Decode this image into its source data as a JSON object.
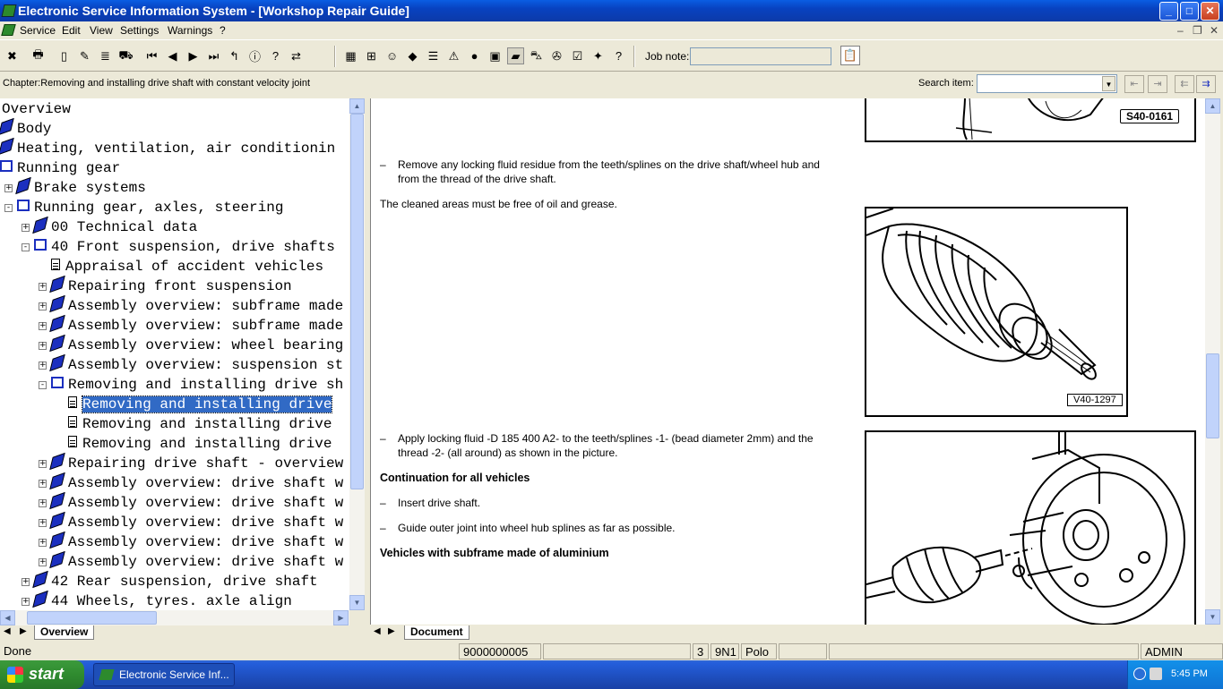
{
  "window": {
    "title": "Electronic Service Information System - [Workshop Repair Guide]",
    "controls": {
      "minimize": "_",
      "maximize": "□",
      "close": "✕"
    }
  },
  "menu": {
    "items": [
      "Service",
      "Edit",
      "View",
      "Settings",
      "Warnings",
      "?"
    ],
    "mdi": {
      "minimize": "–",
      "restore": "❐",
      "close": "✕"
    }
  },
  "toolbar": {
    "job_note_label": "Job note:",
    "job_note_value": "",
    "buttons_left": [
      {
        "icon": "exit-icon",
        "glyph": "✖"
      },
      {
        "icon": "print-icon",
        "glyph": "🖶"
      },
      {
        "icon": "new-document-icon",
        "glyph": "▯"
      },
      {
        "icon": "edit-document-icon",
        "glyph": "✎"
      },
      {
        "icon": "document-list-icon",
        "glyph": "≣"
      },
      {
        "icon": "vehicle-icon",
        "glyph": "⛟"
      }
    ],
    "buttons_nav": [
      {
        "icon": "first-icon",
        "glyph": "⏮"
      },
      {
        "icon": "previous-icon",
        "glyph": "◀"
      },
      {
        "icon": "next-icon",
        "glyph": "▶"
      },
      {
        "icon": "last-icon",
        "glyph": "⏭"
      },
      {
        "icon": "up-level-icon",
        "glyph": "↰"
      },
      {
        "icon": "info-icon",
        "glyph": "ⓘ"
      },
      {
        "icon": "help-icon",
        "glyph": "?"
      },
      {
        "icon": "swap-icon",
        "glyph": "⇄"
      }
    ],
    "buttons_modules": [
      {
        "icon": "calculator-icon",
        "glyph": "▦"
      },
      {
        "icon": "circuit-icon",
        "glyph": "⊞"
      },
      {
        "icon": "people-icon",
        "glyph": "☺"
      },
      {
        "icon": "red-book-icon",
        "glyph": "◆"
      },
      {
        "icon": "list-book-icon",
        "glyph": "☰"
      },
      {
        "icon": "warning-icon",
        "glyph": "⚠"
      },
      {
        "icon": "globe-icon",
        "glyph": "●"
      },
      {
        "icon": "save-disk-icon",
        "glyph": "▣"
      },
      {
        "icon": "repair-guide-icon",
        "glyph": "▰",
        "pressed": true
      },
      {
        "icon": "car-icon",
        "glyph": "⛍"
      },
      {
        "icon": "diagnosis-icon",
        "glyph": "✇"
      },
      {
        "icon": "checklist-icon",
        "glyph": "☑"
      },
      {
        "icon": "tools-icon",
        "glyph": "✦"
      },
      {
        "icon": "help-book-icon",
        "glyph": "?"
      }
    ],
    "clipboard_icon": "📋"
  },
  "chapter": {
    "text": "Chapter:Removing and installing drive shaft with constant velocity joint",
    "search_label": "Search item:",
    "search_value": ""
  },
  "tree": {
    "nodes": [
      {
        "label": "Overview",
        "icon": "none",
        "level": 0,
        "expander": ""
      },
      {
        "label": "Body",
        "icon": "book",
        "level": 0,
        "expander": ""
      },
      {
        "label": "Heating, ventilation, air conditionin",
        "icon": "book",
        "level": 0,
        "expander": ""
      },
      {
        "label": "Running gear",
        "icon": "openbook",
        "level": 0,
        "expander": ""
      },
      {
        "label": "Brake systems",
        "icon": "book",
        "level": 1,
        "expander": "+"
      },
      {
        "label": "Running gear, axles, steering",
        "icon": "openbook",
        "level": 1,
        "expander": "-"
      },
      {
        "label": "00 Technical data",
        "icon": "book",
        "level": 2,
        "expander": "+"
      },
      {
        "label": "40 Front suspension, drive shafts",
        "icon": "openbook",
        "level": 2,
        "expander": "-"
      },
      {
        "label": "Appraisal of accident vehicles",
        "icon": "page",
        "level": 3,
        "expander": ""
      },
      {
        "label": "Repairing front suspension",
        "icon": "book",
        "level": 3,
        "expander": "+"
      },
      {
        "label": "Assembly overview: subframe made",
        "icon": "book",
        "level": 3,
        "expander": "+"
      },
      {
        "label": "Assembly overview: subframe made",
        "icon": "book",
        "level": 3,
        "expander": "+"
      },
      {
        "label": "Assembly overview: wheel bearing",
        "icon": "book",
        "level": 3,
        "expander": "+"
      },
      {
        "label": "Assembly overview: suspension st",
        "icon": "book",
        "level": 3,
        "expander": "+"
      },
      {
        "label": "Removing and installing drive sh",
        "icon": "openbook",
        "level": 3,
        "expander": "-"
      },
      {
        "label": "Removing and installing drive",
        "icon": "page",
        "level": 4,
        "expander": "",
        "selected": true
      },
      {
        "label": "Removing and installing drive",
        "icon": "page",
        "level": 4,
        "expander": ""
      },
      {
        "label": "Removing and installing drive",
        "icon": "page",
        "level": 4,
        "expander": ""
      },
      {
        "label": "Repairing drive shaft - overview",
        "icon": "book",
        "level": 3,
        "expander": "+"
      },
      {
        "label": "Assembly overview: drive shaft w",
        "icon": "book",
        "level": 3,
        "expander": "+"
      },
      {
        "label": "Assembly overview: drive shaft w",
        "icon": "book",
        "level": 3,
        "expander": "+"
      },
      {
        "label": "Assembly overview: drive shaft w",
        "icon": "book",
        "level": 3,
        "expander": "+"
      },
      {
        "label": "Assembly overview: drive shaft w",
        "icon": "book",
        "level": 3,
        "expander": "+"
      },
      {
        "label": "Assembly overview: drive shaft w",
        "icon": "book",
        "level": 3,
        "expander": "+"
      },
      {
        "label": "42 Rear suspension, drive shaft",
        "icon": "book",
        "level": 2,
        "expander": "+"
      },
      {
        "label": "44 Wheels, tyres. axle align",
        "icon": "book",
        "level": 2,
        "expander": "+"
      }
    ],
    "tab_label": "Overview"
  },
  "document": {
    "fig1_label": "S40-0161",
    "step1_dash": "–",
    "step1_line1": "Remove any locking fluid residue from the teeth/splines on the drive shaft/wheel hub and",
    "step1_line2": "from the thread of the drive shaft.",
    "note1": "The cleaned areas must be free of oil and grease.",
    "fig2_label": "V40-1297",
    "step2_dash": "–",
    "step2_line1": "Apply locking fluid -D 185 400 A2- to the teeth/splines -1- (bead diameter 2mm) and the",
    "step2_line2": "thread -2- (all around) as shown in the picture.",
    "heading1": "Continuation for all vehicles",
    "step3_dash": "–",
    "step3": "Insert drive shaft.",
    "step4_dash": "–",
    "step4": "Guide outer joint into wheel hub splines as far as possible.",
    "heading2": "Vehicles with subframe made of aluminium",
    "tab_label": "Document"
  },
  "status": {
    "left": "Done",
    "doc_number": "9000000005",
    "field_a": "",
    "count": "3",
    "model_code": "9N1",
    "model": "Polo",
    "field_b": "",
    "field_c": "",
    "user": "ADMIN"
  },
  "taskbar": {
    "start_label": "start",
    "task_label": "Electronic Service Inf...",
    "clock": "5:45 PM"
  }
}
